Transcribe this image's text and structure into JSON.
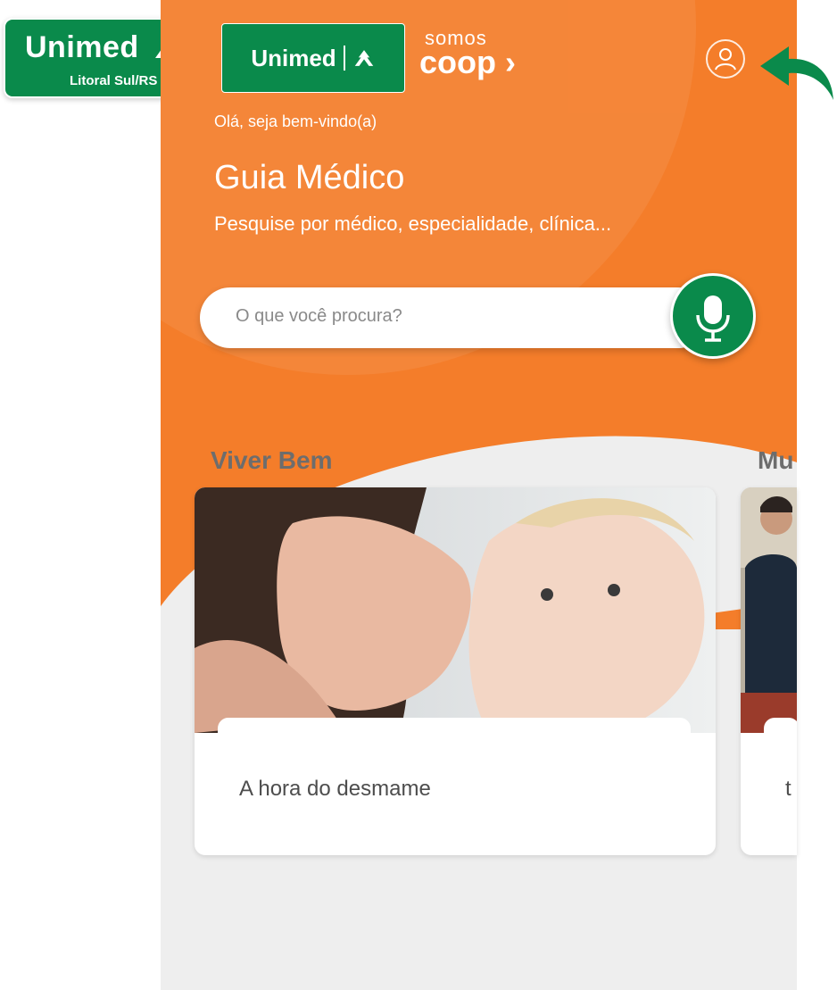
{
  "brand": {
    "name": "Unimed",
    "region": "Litoral Sul/RS",
    "coop_line1": "somos",
    "coop_line2": "coop",
    "green": "#0a8a4b",
    "orange": "#f47d2a"
  },
  "header": {
    "greeting": "Olá, seja bem-vindo(a)",
    "title": "Guia Médico",
    "subtitle": "Pesquise por médico, especialidade, clínica...",
    "profile_icon": "user-circle-icon",
    "arrow_icon": "curved-arrow-icon"
  },
  "search": {
    "placeholder": "O que você procura?",
    "mic_icon": "microphone-icon"
  },
  "sections": [
    {
      "title": "Viver Bem",
      "card_text": "A hora do desmame"
    },
    {
      "title": "Mu",
      "card_text": "t"
    }
  ]
}
